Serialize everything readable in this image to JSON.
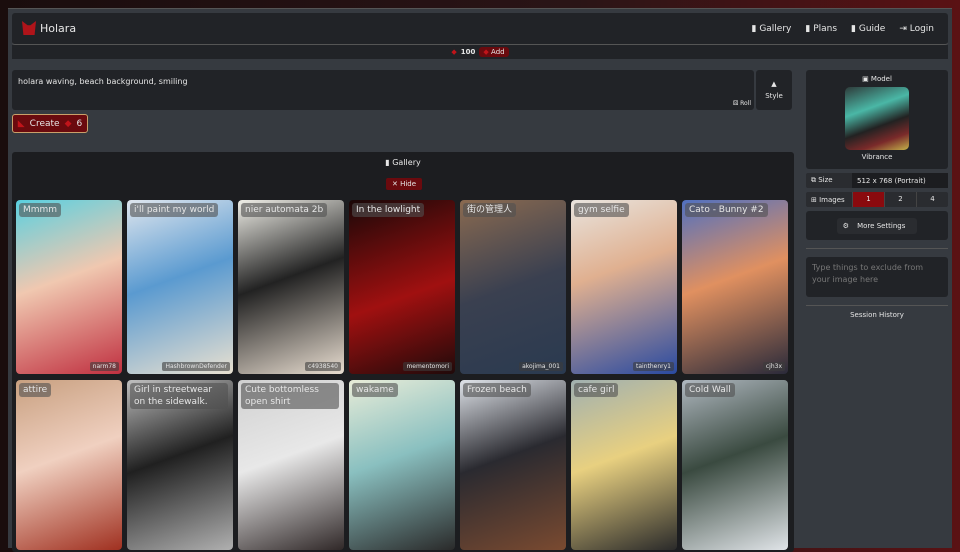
{
  "nav": {
    "brand": "Holara",
    "links": [
      "Gallery",
      "Plans",
      "Guide",
      "Login"
    ]
  },
  "credits": {
    "amount": "100",
    "add": "Add"
  },
  "prompt": {
    "value": "holara waving, beach background, smiling",
    "roll": "Roll",
    "style": "Style"
  },
  "create": {
    "label": "Create",
    "cost": "6"
  },
  "gallery": {
    "title": "Gallery",
    "hide": "✕ Hide",
    "cards": [
      {
        "title": "Mmmm",
        "user": "narm78",
        "bg": "linear-gradient(160deg,#5ad0e0,#f0c8b0 45%,#c03040)"
      },
      {
        "title": "i'll paint my world",
        "user": "HashbrownDefender",
        "bg": "linear-gradient(160deg,#dfe6ee,#5a9ad0 45%,#e8e0d0)"
      },
      {
        "title": "nier automata 2b",
        "user": "c4938540",
        "bg": "linear-gradient(160deg,#f0efe8,#222 45%,#e8ddd0)"
      },
      {
        "title": "In the lowlight",
        "user": "mementomori",
        "bg": "linear-gradient(160deg,#1a0808,#a01010 55%,#200a0a)"
      },
      {
        "title": "街の管理人",
        "user": "akojima_001",
        "bg": "linear-gradient(160deg,#8a6a50,#3a4050 50%,#2a3a50)"
      },
      {
        "title": "gym selfie",
        "user": "tainthenry1",
        "bg": "linear-gradient(160deg,#e8e4de,#e0b090 40%,#2a4aa0)"
      },
      {
        "title": "Cato - Bunny #2",
        "user": "cjh3x",
        "bg": "linear-gradient(160deg,#5070c0,#e09060 45%,#2a2a3a)"
      },
      {
        "title": "attire",
        "user": "",
        "bg": "linear-gradient(160deg,#c8a080,#f0d0c0 45%,#a03020)"
      },
      {
        "title": "Girl in streetwear on the sidewalk.",
        "user": "",
        "bg": "linear-gradient(160deg,#c0c0c0,#202020 45%,#b0b0b0)"
      },
      {
        "title": "Cute bottomless open shirt",
        "user": "",
        "bg": "linear-gradient(160deg,#d0d0d0,#e8e8e8 45%,#302828)"
      },
      {
        "title": "wakame",
        "user": "",
        "bg": "linear-gradient(160deg,#e8ecd8,#8ac0c0 45%,#2a2a2a)"
      },
      {
        "title": "Frozen beach",
        "user": "",
        "bg": "linear-gradient(160deg,#e0e4ea,#2a2a30 45%,#7a4a30)"
      },
      {
        "title": "cafe girl",
        "user": "",
        "bg": "linear-gradient(160deg,#a0b0b0,#e8d080 45%,#2a2a2a)"
      },
      {
        "title": "Cold Wall",
        "user": "",
        "bg": "linear-gradient(160deg,#b0b8c0,#3a4a40 45%,#e0e4e8)"
      }
    ]
  },
  "side": {
    "model_label": "Model",
    "model_name": "Vibrance",
    "size_label": "Size",
    "size_value": "512 x 768 (Portrait)",
    "images_label": "Images",
    "images_options": [
      "1",
      "2",
      "4"
    ],
    "more_settings": "More Settings",
    "negative_placeholder": "Type things to exclude from your image here",
    "session_history": "Session History"
  }
}
